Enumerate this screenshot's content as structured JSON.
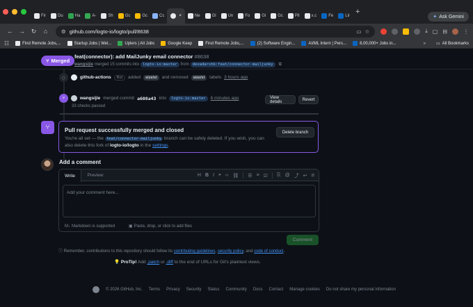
{
  "browser": {
    "tabs": [
      {
        "label": "Fir",
        "color": "#e8eaed"
      },
      {
        "label": "Du",
        "color": "#e8eaed"
      },
      {
        "label": "Ha",
        "color": "#2ea44f"
      },
      {
        "label": "A-",
        "color": "#34a853"
      },
      {
        "label": "Sh",
        "color": "#e8eaed"
      },
      {
        "label": "Gc",
        "color": "#fbbc04"
      },
      {
        "label": "Gc",
        "color": "#fbbc04"
      },
      {
        "label": "Cc",
        "color": "#8ab4f8"
      },
      {
        "label": "",
        "color": "#e8eaed",
        "active": true
      },
      {
        "label": "Ne",
        "color": "#e8eaed"
      },
      {
        "label": "Gl",
        "color": "#e8eaed"
      },
      {
        "label": "Un",
        "color": "#e8eaed"
      },
      {
        "label": "Fo",
        "color": "#e8eaed"
      },
      {
        "label": "Gl",
        "color": "#e8eaed"
      },
      {
        "label": "Gc",
        "color": "#e8eaed"
      },
      {
        "label": "Pll",
        "color": "#e8eaed"
      },
      {
        "label": "x.c",
        "color": "#e8eaed"
      },
      {
        "label": "Fe",
        "color": "#0a66c2"
      },
      {
        "label": "Lir",
        "color": "#0a66c2"
      }
    ],
    "ask_gemini": "Ask Gemini",
    "url": "github.com/logto-io/logto/pull/8638",
    "bookmarks": [
      {
        "label": "Find Remote Jobs,...",
        "color": "#e8eaed"
      },
      {
        "label": "Startup Jobs | Wel...",
        "color": "#e8eaed"
      },
      {
        "label": "Uplers | All Jobs",
        "color": "#34a853"
      },
      {
        "label": "Google Keep",
        "color": "#fbbc04"
      },
      {
        "label": "Find Remote Jobs,...",
        "color": "#e8eaed"
      },
      {
        "label": "(2) Software Engin...",
        "color": "#0a66c2"
      },
      {
        "label": "AI/ML Intern | Pers...",
        "color": "#0a66c2"
      },
      {
        "label": "8,00,000+ Jobs in...",
        "color": "#0a66c2"
      }
    ],
    "all_bookmarks": "All Bookmarks"
  },
  "pr": {
    "status": "Merged",
    "title": "feat(connector): add MailJunky email connector",
    "number": "#8638",
    "author": "wangsijie",
    "merged_text": "merged 15 commits into",
    "base": "logto-io:master",
    "from_text": "from",
    "head": "devadarshb:feat/connector-mailjunky"
  },
  "timeline": {
    "label_event": {
      "actor": "github-actions",
      "bot": "Bot",
      "added": "added",
      "added_label": "size/xl",
      "removed": "and removed",
      "removed_label": "size/xl",
      "labels_word": "labels",
      "time": "3 hours ago"
    },
    "merge_event": {
      "actor": "wangsijie",
      "merged_commit": "merged commit",
      "sha": "a608a43",
      "into": "into",
      "branch": "logto-io:master",
      "time": "6 minutes ago",
      "checks": "33 checks passed",
      "view_details": "View details",
      "revert": "Revert"
    }
  },
  "merged_box": {
    "title": "Pull request successfully merged and closed",
    "text_prefix": "You're all set — the",
    "branch": "feat/connector-mailjunky",
    "text_mid": "branch can be safely deleted. If you wish, you can also delete this fork of",
    "repo": "logto-io/logto",
    "text_in": "in the",
    "settings": "settings",
    "text_end": ".",
    "delete_button": "Delete branch"
  },
  "comment": {
    "heading": "Add a comment",
    "tab_write": "Write",
    "tab_preview": "Preview",
    "placeholder": "Add your comment here...",
    "markdown": "Markdown is supported",
    "attach": "Paste, drop, or click to add files",
    "submit": "Comment"
  },
  "reminder": {
    "prefix": "Remember, contributions to this repository should follow its",
    "guidelines": "contributing guidelines",
    "comma": ",",
    "security": "security policy",
    "and": ", and",
    "coc": "code of conduct",
    "dot": "."
  },
  "protip": {
    "label": "ProTip!",
    "add": "Add",
    "patch": ".patch",
    "or": "or",
    "diff": ".diff",
    "rest": "to the end of URLs for Git's plaintext views."
  },
  "footer": {
    "copyright": "© 2026 GitHub, Inc.",
    "links": [
      "Terms",
      "Privacy",
      "Security",
      "Status",
      "Community",
      "Docs",
      "Contact",
      "Manage cookies",
      "Do not share my personal information"
    ]
  }
}
